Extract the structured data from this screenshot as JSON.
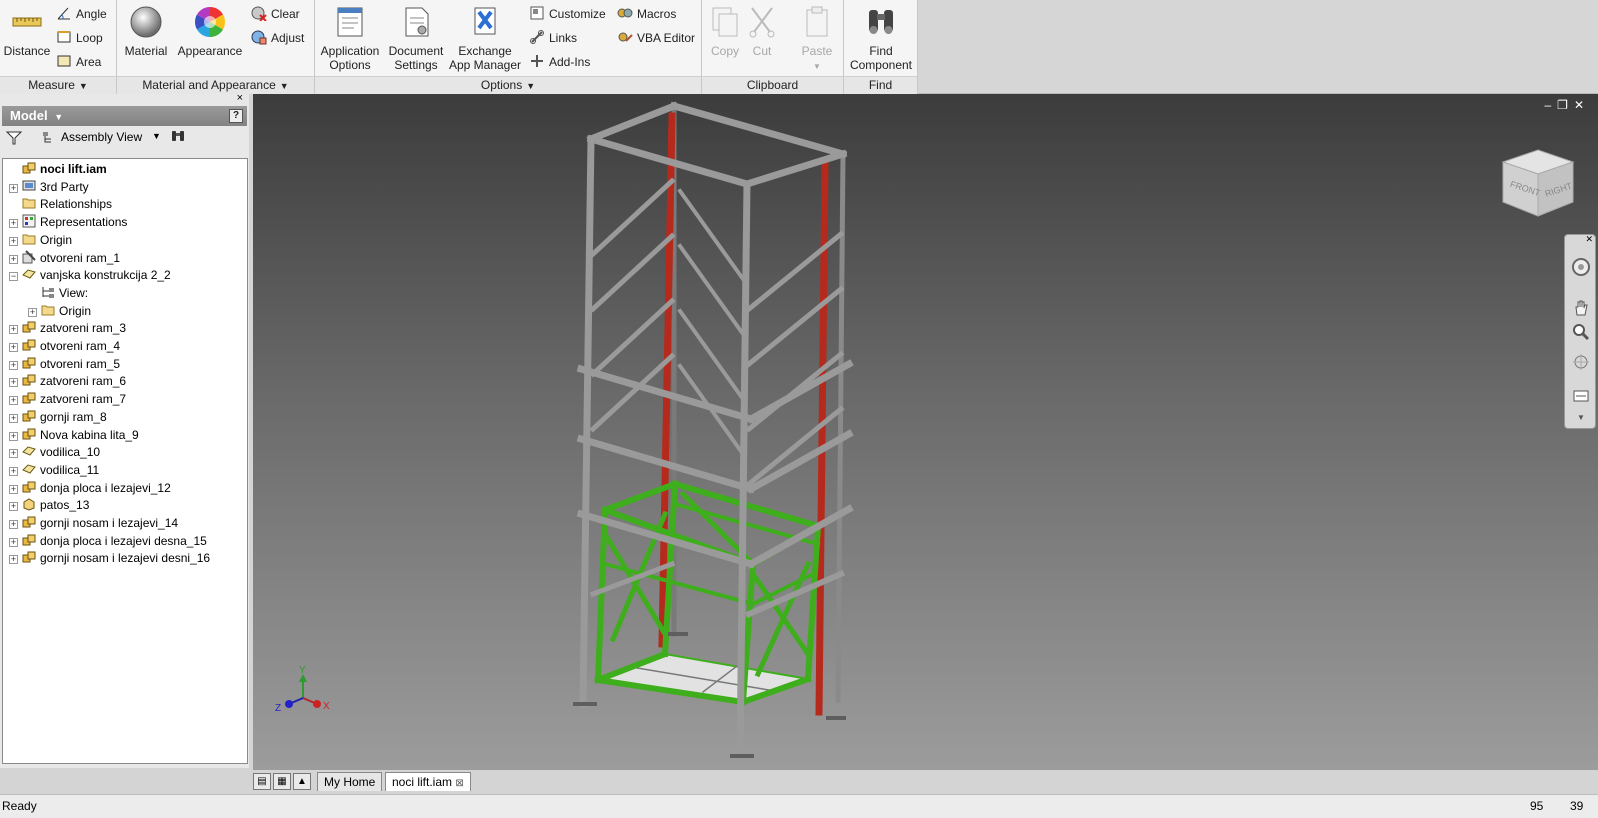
{
  "ribbon": {
    "measure": {
      "distance": "Distance",
      "angle": "Angle",
      "loop": "Loop",
      "area": "Area",
      "footer": "Measure"
    },
    "material_appearance": {
      "material": "Material",
      "appearance": "Appearance",
      "clear": "Clear",
      "adjust": "Adjust",
      "footer": "Material and Appearance"
    },
    "options": {
      "application_line1": "Application",
      "application_line2": "Options",
      "document_line1": "Document",
      "document_line2": "Settings",
      "exchange_line1": "Exchange",
      "exchange_line2": "App Manager",
      "customize": "Customize",
      "links": "Links",
      "addins": "Add-Ins",
      "macros": "Macros",
      "vba": "VBA Editor",
      "footer": "Options"
    },
    "clipboard": {
      "copy": "Copy",
      "cut": "Cut",
      "paste": "Paste",
      "footer": "Clipboard"
    },
    "find": {
      "find_line1": "Find",
      "find_line2": "Component",
      "footer": "Find"
    }
  },
  "browser": {
    "close_glyph": "×",
    "title": "Model",
    "help": "?",
    "view_dropdown": "Assembly View",
    "tree": [
      {
        "label": "noci lift.iam",
        "level": 0,
        "expander": "",
        "icon": "assembly-icon",
        "bold": true
      },
      {
        "label": "3rd Party",
        "level": 0,
        "expander": "+",
        "icon": "third-party-icon"
      },
      {
        "label": "Relationships",
        "level": 0,
        "expander": "",
        "icon": "folder-icon"
      },
      {
        "label": "Representations",
        "level": 0,
        "expander": "+",
        "icon": "representations-icon"
      },
      {
        "label": "Origin",
        "level": 0,
        "expander": "+",
        "icon": "folder-icon"
      },
      {
        "label": "otvoreni ram_1",
        "level": 0,
        "expander": "+",
        "icon": "weldment-icon"
      },
      {
        "label": "vanjska konstrukcija 2_2",
        "level": 0,
        "expander": "−",
        "icon": "part-icon"
      },
      {
        "label": "View:",
        "level": 1,
        "expander": "",
        "icon": "view-icon"
      },
      {
        "label": "Origin",
        "level": 1,
        "expander": "+",
        "icon": "folder-icon"
      },
      {
        "label": "zatvoreni ram_3",
        "level": 0,
        "expander": "+",
        "icon": "assembly-icon"
      },
      {
        "label": "otvoreni ram_4",
        "level": 0,
        "expander": "+",
        "icon": "assembly-icon"
      },
      {
        "label": "otvoreni ram_5",
        "level": 0,
        "expander": "+",
        "icon": "assembly-icon"
      },
      {
        "label": "zatvoreni ram_6",
        "level": 0,
        "expander": "+",
        "icon": "assembly-icon"
      },
      {
        "label": "zatvoreni ram_7",
        "level": 0,
        "expander": "+",
        "icon": "assembly-icon"
      },
      {
        "label": "gornji ram_8",
        "level": 0,
        "expander": "+",
        "icon": "assembly-icon"
      },
      {
        "label": "Nova kabina lita_9",
        "level": 0,
        "expander": "+",
        "icon": "assembly-icon"
      },
      {
        "label": "vodilica_10",
        "level": 0,
        "expander": "+",
        "icon": "part-icon"
      },
      {
        "label": "vodilica_11",
        "level": 0,
        "expander": "+",
        "icon": "part-icon"
      },
      {
        "label": "donja ploca i lezajevi_12",
        "level": 0,
        "expander": "+",
        "icon": "assembly-icon"
      },
      {
        "label": "patos_13",
        "level": 0,
        "expander": "+",
        "icon": "part-block-icon"
      },
      {
        "label": "gornji nosam i lezajevi_14",
        "level": 0,
        "expander": "+",
        "icon": "assembly-icon"
      },
      {
        "label": "donja ploca i lezajevi desna_15",
        "level": 0,
        "expander": "+",
        "icon": "assembly-icon"
      },
      {
        "label": "gornji nosam i lezajevi desni_16",
        "level": 0,
        "expander": "+",
        "icon": "assembly-icon"
      }
    ]
  },
  "viewcube": {
    "front": "FRONT",
    "right": "RIGHT"
  },
  "triad": {
    "x": "X",
    "y": "Y",
    "z": "Z"
  },
  "tabs": [
    {
      "label": "My Home",
      "active": false
    },
    {
      "label": "noci lift.iam",
      "active": true,
      "close": "⊠"
    }
  ],
  "status": {
    "text": "Ready",
    "num1": "95",
    "num2": "39"
  },
  "colors": {
    "frame": "#9a9a9a",
    "rails": "#b52a1c",
    "cabin": "#3fae1c",
    "floor": "#e2e2e2"
  }
}
